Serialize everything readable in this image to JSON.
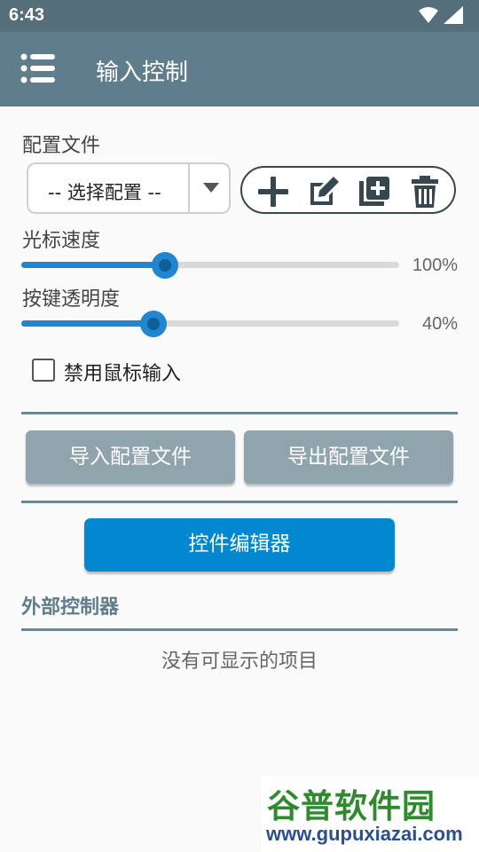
{
  "status": {
    "time": "6:43",
    "icons": [
      "wifi-icon",
      "signal-icon"
    ]
  },
  "app_bar": {
    "title": "输入控制",
    "menu_icon": "menu-icon"
  },
  "profile": {
    "label": "配置文件",
    "select": {
      "selected": "-- 选择配置 --",
      "arrow_icon": "dropdown-arrow-icon"
    },
    "actions": [
      "add-icon",
      "edit-icon",
      "duplicate-icon",
      "delete-icon"
    ]
  },
  "mouse_speed": {
    "label": "光标速度",
    "value": "100%",
    "level": 0.38
  },
  "button_opacity": {
    "label": "按键透明度",
    "value": "40%",
    "level": 0.35
  },
  "disable_mouse": {
    "label": "禁用鼠标输入",
    "checked": false
  },
  "buttons": {
    "import": "导入配置文件",
    "export": "导出配置文件",
    "editor": "控件编辑器"
  },
  "external_controller": {
    "heading": "外部控制器",
    "empty": "没有可显示的项目"
  },
  "watermark": {
    "title": "谷普软件园",
    "url": "www.gupuxiazai.com"
  },
  "colors": {
    "status_bar": "#546e7a",
    "app_bar": "#607d8b",
    "accent": "#1f86cf",
    "primary_button": "#0288d1",
    "gray_button": "#90a4ae"
  }
}
